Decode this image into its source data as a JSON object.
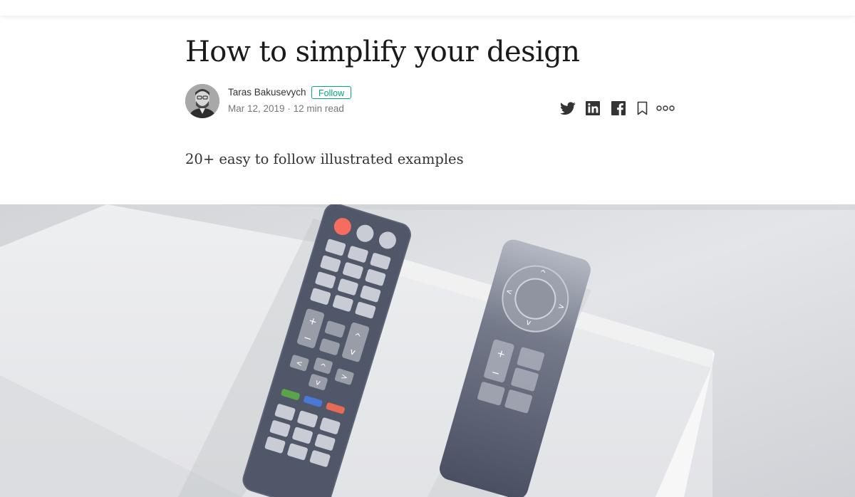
{
  "article": {
    "title": "How to simplify your design",
    "subtitle": "20+ easy to follow illustrated examples"
  },
  "author": {
    "name": "Taras Bakusevych",
    "follow_label": "Follow",
    "date": "Mar 12, 2019",
    "separator": "·",
    "read_time": "12 min read"
  },
  "share": {
    "icons": [
      "twitter-icon",
      "linkedin-icon",
      "facebook-icon",
      "bookmark-icon",
      "more-options-icon"
    ]
  },
  "colors": {
    "accent": "#03a87c",
    "remote_body": "#505768",
    "remote_button": "#c9ccd4",
    "power_button": "#f46d5f",
    "green_button": "#5aa54a",
    "blue_button": "#4a78d6",
    "red_button": "#e66a56"
  },
  "hero": {
    "remote_left": {
      "top_buttons": [
        "power-button",
        "round-button",
        "round-button"
      ],
      "color_buttons": [
        "green-button",
        "blue-button",
        "red-button"
      ],
      "volume_symbols": [
        "+",
        "−"
      ],
      "channel_symbols": [
        "^",
        "v"
      ],
      "dpad_symbols": [
        "<",
        "^",
        "v",
        ">"
      ]
    },
    "remote_right": {
      "ring_symbols": [
        "^",
        "<",
        ">",
        "v"
      ],
      "volume_symbols": [
        "+",
        "−"
      ]
    }
  }
}
